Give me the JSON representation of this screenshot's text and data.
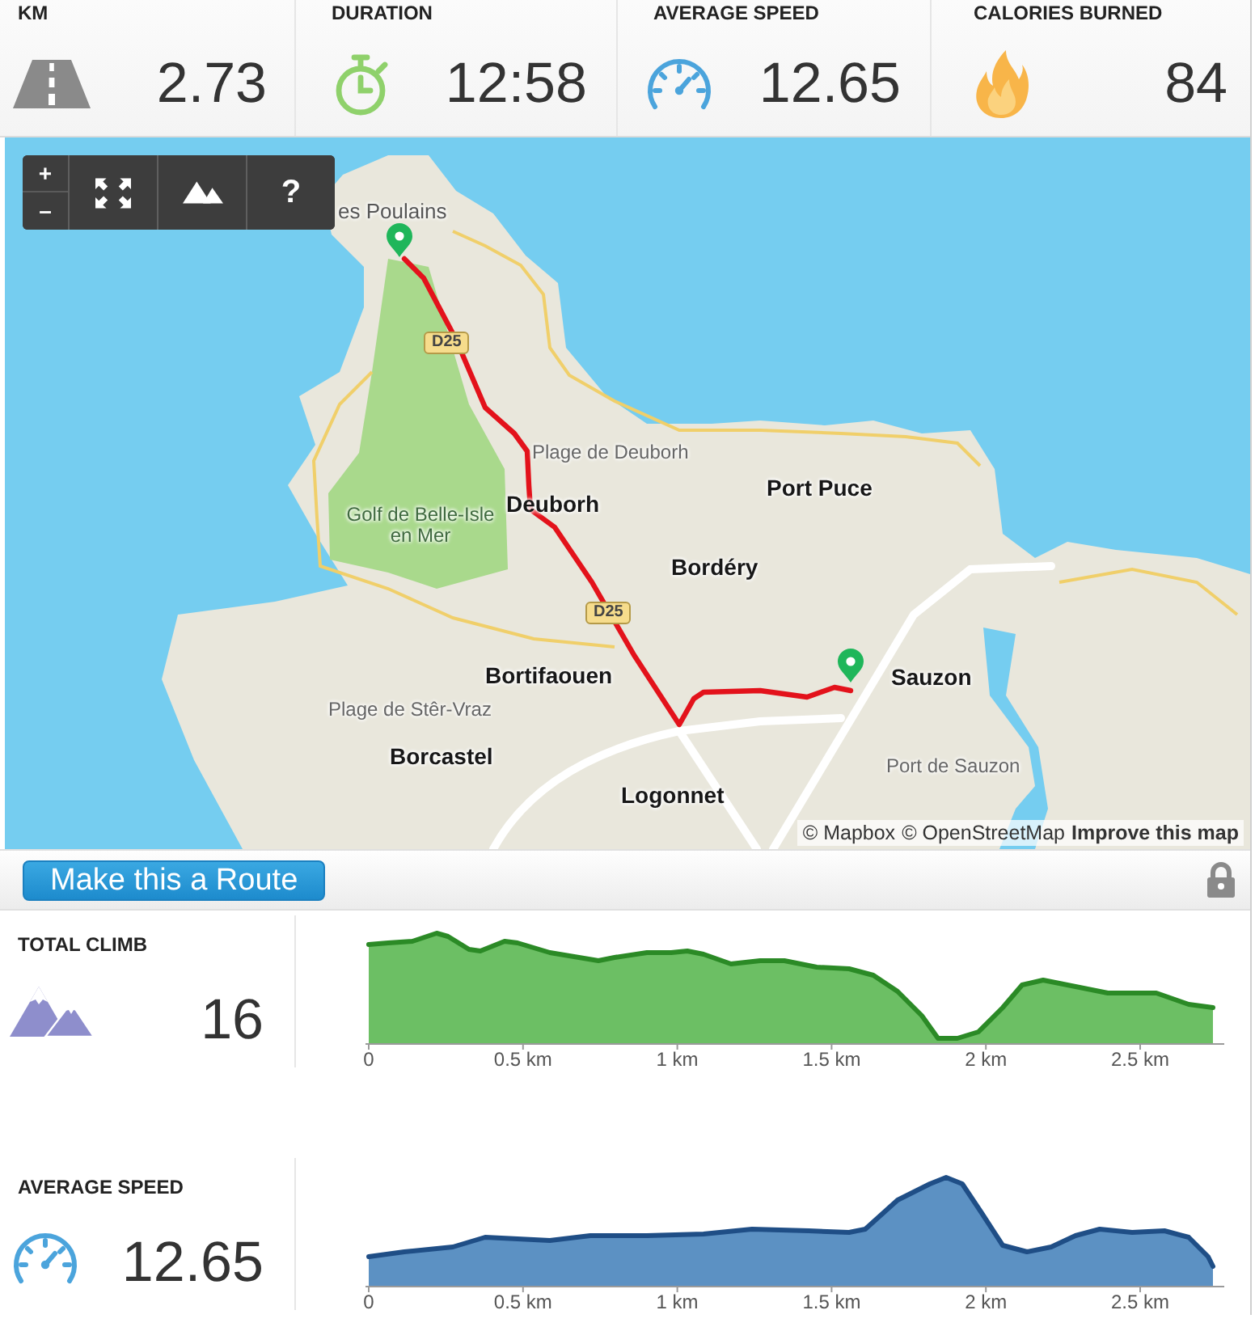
{
  "stats": [
    {
      "kind": "distance",
      "label": "KM",
      "value": "2.73"
    },
    {
      "kind": "duration",
      "label": "DURATION",
      "value": "12:58"
    },
    {
      "kind": "speed",
      "label": "AVERAGE SPEED",
      "value": "12.65"
    },
    {
      "kind": "calories",
      "label": "CALORIES BURNED",
      "value": "84"
    }
  ],
  "map": {
    "controls": {
      "zoom_in": "+",
      "zoom_out": "–",
      "help": "?"
    },
    "places": [
      {
        "name": "es Poulains",
        "kind": "locality"
      },
      {
        "name": "Plage de Deuborh",
        "kind": "poi"
      },
      {
        "name": "Port Puce",
        "kind": "town"
      },
      {
        "name": "Deuborh",
        "kind": "town"
      },
      {
        "name": "Golf de Belle-Isle en Mer",
        "kind": "park"
      },
      {
        "name": "Bordéry",
        "kind": "town"
      },
      {
        "name": "Bortifaouen",
        "kind": "town"
      },
      {
        "name": "Sauzon",
        "kind": "town"
      },
      {
        "name": "Plage de Stêr-Vraz",
        "kind": "poi"
      },
      {
        "name": "Borcastel",
        "kind": "town"
      },
      {
        "name": "Port de Sauzon",
        "kind": "poi"
      },
      {
        "name": "Logonnet",
        "kind": "town"
      }
    ],
    "road_badges": [
      "D25",
      "D25"
    ],
    "attribution": {
      "links": [
        "© Mapbox",
        "© OpenStreetMap"
      ],
      "improve_link": "Improve this map"
    }
  },
  "route_bar": {
    "button": "Make this a Route",
    "locked": true
  },
  "profiles": [
    {
      "kind": "elevation",
      "label": "TOTAL CLIMB",
      "value": "16",
      "x_labels": [
        "0",
        "0.5 km",
        "1 km",
        "1.5 km",
        "2 km",
        "2.5 km"
      ]
    },
    {
      "kind": "speed",
      "label": "AVERAGE SPEED",
      "value": "12.65",
      "x_labels": [
        "0",
        "0.5 km",
        "1 km",
        "1.5 km",
        "2 km",
        "2.5 km"
      ]
    }
  ]
}
